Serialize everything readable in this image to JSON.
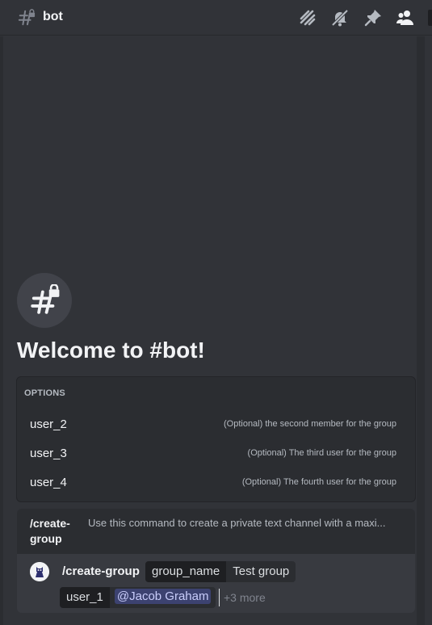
{
  "header": {
    "channel_name": "bot",
    "icons": [
      "threads-icon",
      "mute-notifications-icon",
      "pin-icon",
      "member-list-icon"
    ]
  },
  "welcome": {
    "title": "Welcome to #bot!"
  },
  "options": {
    "header": "OPTIONS",
    "items": [
      {
        "name": "user_2",
        "description": "(Optional) the second member for the group"
      },
      {
        "name": "user_3",
        "description": "(Optional) The third user for the group"
      },
      {
        "name": "user_4",
        "description": "(Optional) The fourth user for the group"
      }
    ]
  },
  "command": {
    "name": "/create-group",
    "name_line1": "/create-",
    "name_line2": "group",
    "description": "Use this command to create a private text channel with a maxi..."
  },
  "input": {
    "command": "/create-group",
    "group_name_key": "group_name",
    "group_name_value": "Test group",
    "user1_key": "user_1",
    "user1_value": "@Jacob Graham",
    "more": "+3 more"
  },
  "colors": {
    "background": "#313338",
    "popup": "#2b2d31",
    "mention": "#3c4270"
  }
}
